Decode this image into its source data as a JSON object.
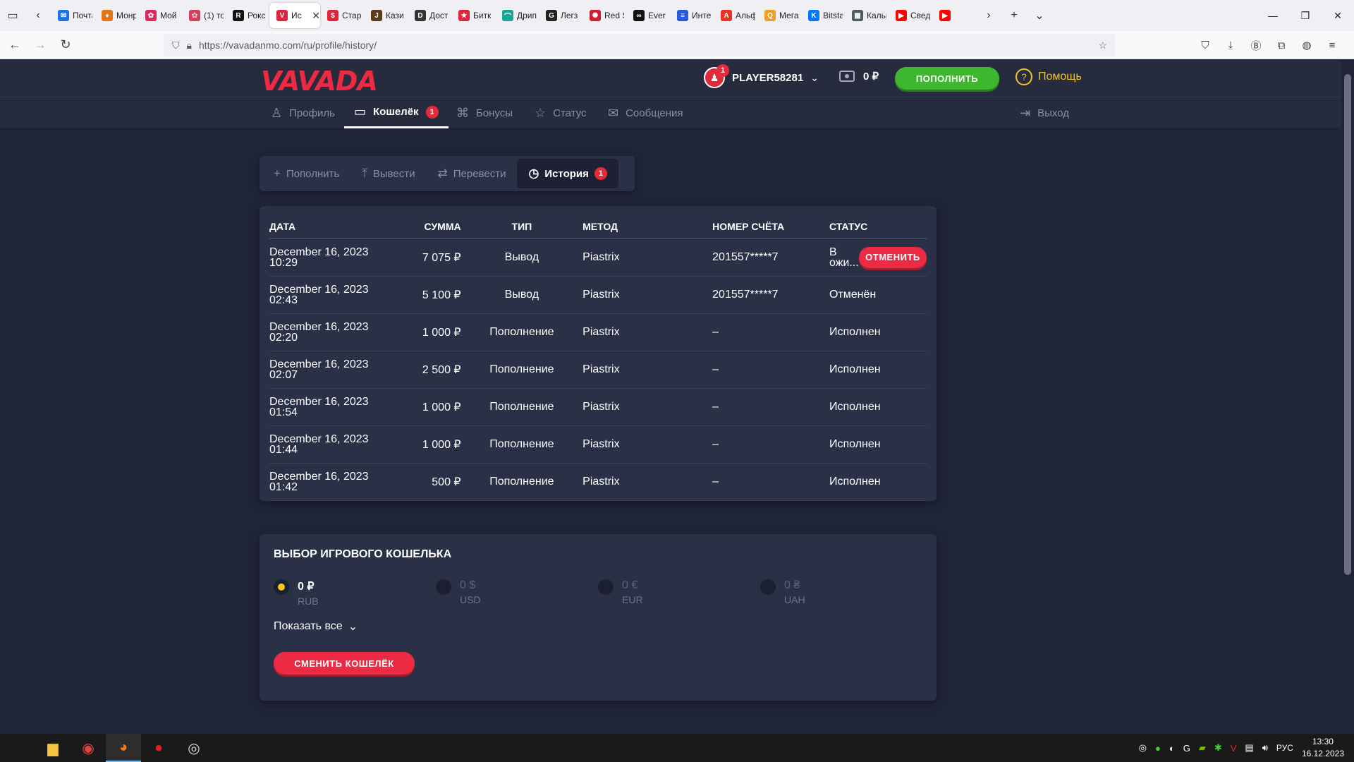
{
  "browser": {
    "tabs": [
      {
        "label": "Почта",
        "color": "#1a73e8",
        "glyph": "✉"
      },
      {
        "label": "Монр",
        "color": "#e2761b",
        "glyph": "♦"
      },
      {
        "label": "Мой",
        "color": "#e0245e",
        "glyph": "✿"
      },
      {
        "label": "(1) то",
        "color": "#d0405a",
        "glyph": "✩"
      },
      {
        "label": "Рокс",
        "color": "#111111",
        "glyph": "R"
      },
      {
        "label": "Ис",
        "color": "#e0243a",
        "glyph": "V",
        "active": true
      },
      {
        "label": "Стар",
        "color": "#e0243a",
        "glyph": "$"
      },
      {
        "label": "Кази",
        "color": "#5a3b1a",
        "glyph": "J"
      },
      {
        "label": "Дост",
        "color": "#333333",
        "glyph": "D"
      },
      {
        "label": "Битк",
        "color": "#e0243a",
        "glyph": "★"
      },
      {
        "label": "Дрип",
        "color": "#1aa39a",
        "glyph": "⌒"
      },
      {
        "label": "Легз",
        "color": "#222222",
        "glyph": "G"
      },
      {
        "label": "Red S",
        "color": "#d01e2e",
        "glyph": "✺"
      },
      {
        "label": "Ever",
        "color": "#111111",
        "glyph": "∞"
      },
      {
        "label": "Интер",
        "color": "#2a5bd7",
        "glyph": "≡"
      },
      {
        "label": "Альф",
        "color": "#ef3124",
        "glyph": "A"
      },
      {
        "label": "Мега",
        "color": "#f0a020",
        "glyph": "Q"
      },
      {
        "label": "Bitsta",
        "color": "#0077ff",
        "glyph": "K"
      },
      {
        "label": "Кальк",
        "color": "#4f5b66",
        "glyph": "▦"
      },
      {
        "label": "Сведе",
        "color": "#ff0000",
        "glyph": "▶"
      },
      {
        "label": "",
        "color": "#ff0000",
        "glyph": "▶"
      }
    ],
    "url": "https://vavadanmo.com/ru/profile/history/"
  },
  "site": {
    "logo": "VAVADA",
    "username": "PLAYER58281",
    "avatar_badge": "1",
    "balance": "0 ₽",
    "topup_label": "ПОПОЛНИТЬ",
    "help_label": "Помощь",
    "nav": {
      "profile": "Профиль",
      "wallet": "Кошелёк",
      "wallet_badge": "1",
      "bonuses": "Бонусы",
      "status": "Статус",
      "messages": "Сообщения",
      "logout": "Выход"
    },
    "subtabs": {
      "deposit": "Пополнить",
      "withdraw": "Вывести",
      "transfer": "Перевести",
      "history": "История",
      "history_badge": "1"
    }
  },
  "history": {
    "columns": {
      "date": "ДАТА",
      "amount": "СУММА",
      "type": "ТИП",
      "method": "МЕТОД",
      "account": "НОМЕР СЧЁТА",
      "status": "СТАТУС"
    },
    "cancel_label": "ОТМЕНИТЬ",
    "rows": [
      {
        "date": "December 16, 2023",
        "time": "10:29",
        "amount": "7 075 ₽",
        "type": "Вывод",
        "method": "Piastrix",
        "account": "201557*****7",
        "status": "В ожи..."
      },
      {
        "date": "December 16, 2023",
        "time": "02:43",
        "amount": "5 100 ₽",
        "type": "Вывод",
        "method": "Piastrix",
        "account": "201557*****7",
        "status": "Отменён"
      },
      {
        "date": "December 16, 2023",
        "time": "02:20",
        "amount": "1 000 ₽",
        "type": "Пополнение",
        "method": "Piastrix",
        "account": "–",
        "status": "Исполнен"
      },
      {
        "date": "December 16, 2023",
        "time": "02:07",
        "amount": "2 500 ₽",
        "type": "Пополнение",
        "method": "Piastrix",
        "account": "–",
        "status": "Исполнен"
      },
      {
        "date": "December 16, 2023",
        "time": "01:54",
        "amount": "1 000 ₽",
        "type": "Пополнение",
        "method": "Piastrix",
        "account": "–",
        "status": "Исполнен"
      },
      {
        "date": "December 16, 2023",
        "time": "01:44",
        "amount": "1 000 ₽",
        "type": "Пополнение",
        "method": "Piastrix",
        "account": "–",
        "status": "Исполнен"
      },
      {
        "date": "December 16, 2023",
        "time": "01:42",
        "amount": "500 ₽",
        "type": "Пополнение",
        "method": "Piastrix",
        "account": "–",
        "status": "Исполнен"
      }
    ]
  },
  "wallet": {
    "title": "ВЫБОР ИГРОВОГО КОШЕЛЬКА",
    "currencies": [
      {
        "amount": "0 ₽",
        "code": "RUB",
        "selected": true
      },
      {
        "amount": "0 $",
        "code": "USD",
        "selected": false
      },
      {
        "amount": "0 €",
        "code": "EUR",
        "selected": false
      },
      {
        "amount": "0 ₴",
        "code": "UAH",
        "selected": false
      }
    ],
    "show_all": "Показать все",
    "change_label": "СМЕНИТЬ КОШЕЛЁК"
  },
  "taskbar": {
    "lang": "РУС",
    "time": "13:30",
    "date": "16.12.2023"
  },
  "colors": {
    "brand_red": "#ec2a43",
    "topup_green": "#3fb630",
    "help_yellow": "#f5c623",
    "page_bg": "#1f2438",
    "card_bg": "#2a3045"
  }
}
